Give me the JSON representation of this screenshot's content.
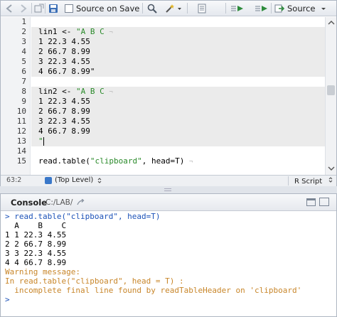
{
  "toolbar": {
    "source_on_save_label": "Source on Save",
    "source_button_label": "Source",
    "colors": {
      "save": "#3b6fb6",
      "run": "#2e8b3c"
    }
  },
  "editor": {
    "lines": [
      {
        "n": "1",
        "text": ""
      },
      {
        "n": "2",
        "text": "lin1 <- \"A B C "
      },
      {
        "n": "3",
        "text": "1 22.3 4.55 "
      },
      {
        "n": "4",
        "text": "2 66.7 8.99 "
      },
      {
        "n": "5",
        "text": "3 22.3 4.55 "
      },
      {
        "n": "6",
        "text": "4 66.7 8.99\""
      },
      {
        "n": "7",
        "text": ""
      },
      {
        "n": "8",
        "text": "lin2 <- \"A B C "
      },
      {
        "n": "9",
        "text": "1 22.3 4.55 "
      },
      {
        "n": "10",
        "text": "2 66.7 8.99 "
      },
      {
        "n": "11",
        "text": "3 22.3 4.55 "
      },
      {
        "n": "12",
        "text": "4 66.7 8.99 "
      },
      {
        "n": "13",
        "text": "\""
      },
      {
        "n": "14",
        "text": ""
      },
      {
        "n": "15",
        "text": "read.table(\"clipboard\", head=T) "
      }
    ]
  },
  "statusbar": {
    "position": "63:2",
    "scope": "(Top Level)",
    "file_type": "R Script"
  },
  "console": {
    "title": "Console",
    "path": "C:/LAB/",
    "lines": [
      {
        "kind": "cmd",
        "text": "> read.table(\"clipboard\", head=T)"
      },
      {
        "kind": "out",
        "text": "  A    B    C"
      },
      {
        "kind": "out",
        "text": "1 1 22.3 4.55"
      },
      {
        "kind": "out",
        "text": "2 2 66.7 8.99"
      },
      {
        "kind": "out",
        "text": "3 3 22.3 4.55"
      },
      {
        "kind": "out",
        "text": "4 4 66.7 8.99"
      },
      {
        "kind": "warn",
        "text": "Warning message:"
      },
      {
        "kind": "warn",
        "text": "In read.table(\"clipboard\", head = T) :"
      },
      {
        "kind": "warn",
        "text": "  incomplete final line found by readTableHeader on 'clipboard'"
      },
      {
        "kind": "cmd",
        "text": ">"
      }
    ]
  }
}
